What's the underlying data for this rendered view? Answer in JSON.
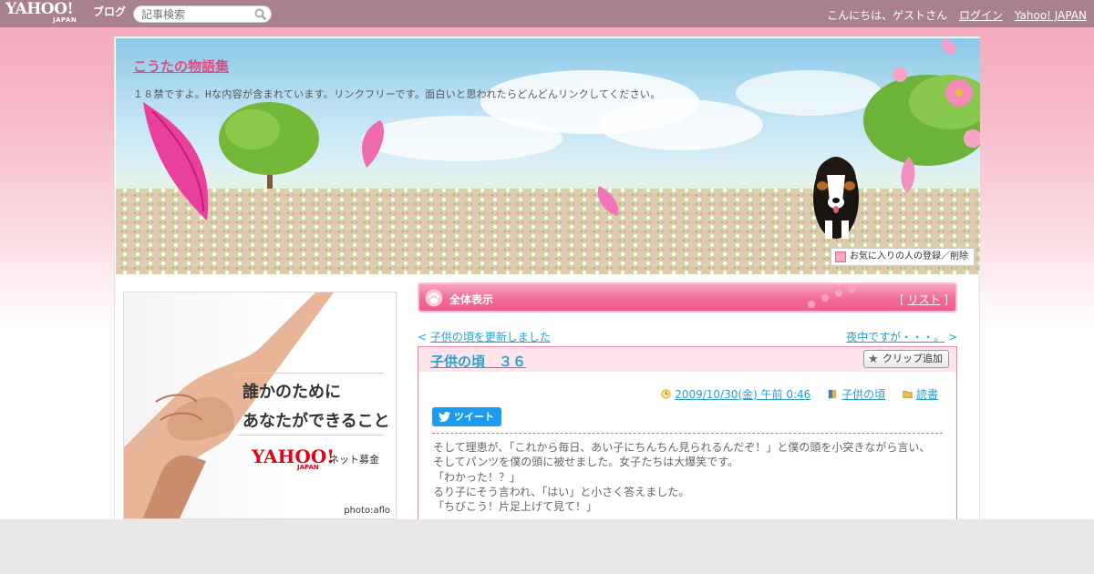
{
  "topbar": {
    "logo_text": "YAHOO!",
    "logo_sub": "JAPAN",
    "logo_service": "ブログ",
    "search_placeholder": "記事検索",
    "greeting": "こんにちは、ゲストさん",
    "login_label": "ログイン",
    "yahoo_japan_label": "Yahoo! JAPAN"
  },
  "header": {
    "blog_title": "こうたの物語集",
    "description": "１８禁ですよ。Hな内容が含まれています。リンクフリーです。面白いと思われたらどんどんリンクしてください。",
    "favorite_button": "お気に入りの人の登録／削除"
  },
  "sidebar_ad": {
    "line1": "誰かのために",
    "line2": "あなたができること",
    "logo": "YAHOO!",
    "logo_sub": "JAPAN",
    "service": "ネット募金",
    "credit": "photo:aflo"
  },
  "view_bar": {
    "title": "全体表示",
    "list_label": "リスト"
  },
  "nav": {
    "prev": "子供の頃を更新しました",
    "next": "夜中ですが・・・。"
  },
  "article": {
    "title": "子供の頃　３６",
    "clip_button": "クリップ追加",
    "date": "2009/10/30(金) 午前 0:46",
    "category": "子供の頃",
    "folder": "読書",
    "tweet_button": "ツイート",
    "body": [
      "そして理恵が、「これから毎日、あい子にちんちん見られるんだぞ！」と僕の頭を小突きながら言い、",
      "そしてパンツを僕の頭に被せました。女子たちは大爆笑です。",
      "「わかった！？」",
      "るり子にそう言われ、「はい」と小さく答えました。",
      "「ちびこう！片足上げて見て！」"
    ]
  },
  "colors": {
    "topbar": "#a8808f",
    "accent_pink": "#ee5c8c",
    "link_blue": "#2a9fd0",
    "title_pink": "#e04b82"
  }
}
